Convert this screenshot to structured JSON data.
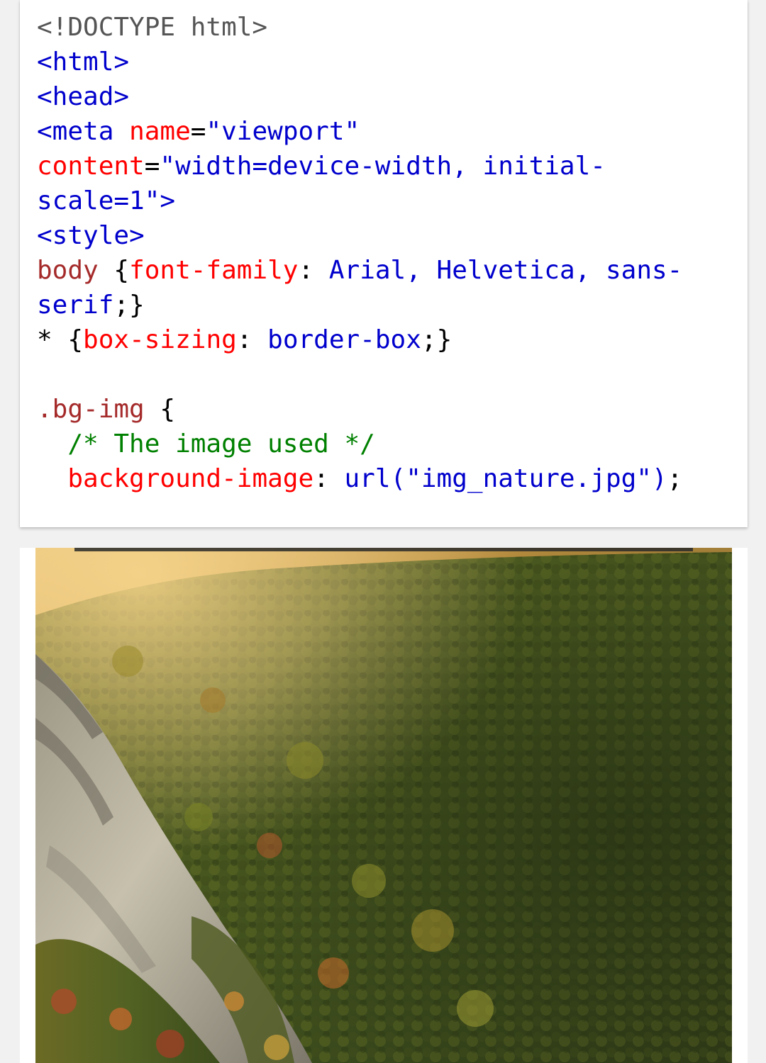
{
  "code_example": {
    "lines": [
      [
        {
          "t": "<!DOCTYPE html>",
          "c": "doctype"
        }
      ],
      [
        {
          "t": "<html>",
          "c": "tag"
        }
      ],
      [
        {
          "t": "<head>",
          "c": "tag"
        }
      ],
      [
        {
          "t": "<meta",
          "c": "tag"
        },
        {
          "t": " ",
          "c": "plain"
        },
        {
          "t": "name",
          "c": "attr"
        },
        {
          "t": "=",
          "c": "punct"
        },
        {
          "t": "\"viewport\"",
          "c": "val"
        }
      ],
      [
        {
          "t": "content",
          "c": "attr"
        },
        {
          "t": "=",
          "c": "punct"
        },
        {
          "t": "\"width=device-width, initial-",
          "c": "val"
        }
      ],
      [
        {
          "t": "scale=1\"",
          "c": "val"
        },
        {
          "t": ">",
          "c": "tag"
        }
      ],
      [
        {
          "t": "<style>",
          "c": "tag"
        }
      ],
      [
        {
          "t": "body",
          "c": "sel"
        },
        {
          "t": " {",
          "c": "punct"
        },
        {
          "t": "font-family",
          "c": "prop"
        },
        {
          "t": ": ",
          "c": "punct"
        },
        {
          "t": "Arial, Helvetica, sans-",
          "c": "val"
        }
      ],
      [
        {
          "t": "serif",
          "c": "val"
        },
        {
          "t": ";}",
          "c": "punct"
        }
      ],
      [
        {
          "t": "* ",
          "c": "punct"
        },
        {
          "t": "{",
          "c": "punct"
        },
        {
          "t": "box-sizing",
          "c": "prop"
        },
        {
          "t": ": ",
          "c": "punct"
        },
        {
          "t": "border-box",
          "c": "val"
        },
        {
          "t": ";}",
          "c": "punct"
        }
      ],
      [
        {
          "t": "",
          "c": "plain"
        }
      ],
      [
        {
          "t": ".bg-img",
          "c": "sel"
        },
        {
          "t": " {",
          "c": "punct"
        }
      ],
      [
        {
          "t": "  ",
          "c": "plain"
        },
        {
          "t": "/* The image used */",
          "c": "comment"
        }
      ],
      [
        {
          "t": "  ",
          "c": "plain"
        },
        {
          "t": "background-image",
          "c": "prop"
        },
        {
          "t": ": ",
          "c": "punct"
        },
        {
          "t": "url(\"img_nature.jpg\")",
          "c": "val"
        },
        {
          "t": ";",
          "c": "punct"
        }
      ]
    ]
  },
  "result_image": {
    "subject": "mountain-forest-photo"
  },
  "colors": {
    "tag": "#0000cd",
    "attribute": "#ff0000",
    "value": "#0000cd",
    "selector": "#a52a2a",
    "comment": "#008000",
    "background": "#f1f1f1",
    "card": "#ffffff"
  }
}
